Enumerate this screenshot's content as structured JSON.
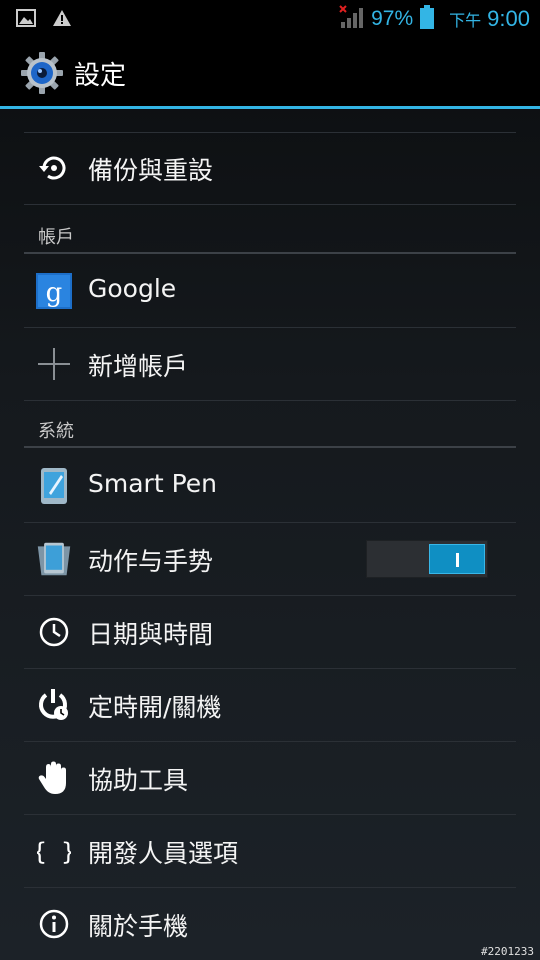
{
  "status_bar": {
    "battery_percent": "97%",
    "ampm": "下午",
    "time": "9:00",
    "icons": [
      "image-notification-icon",
      "warning-icon",
      "no-signal-icon",
      "battery-icon"
    ]
  },
  "action_bar": {
    "title": "設定",
    "icon": "settings-gear-icon"
  },
  "accent_color": "#33b5e5",
  "items": {
    "backup": {
      "label": "備份與重設",
      "icon": "backup-restore-icon"
    },
    "accounts_header": "帳戶",
    "google": {
      "label": "Google",
      "icon": "google-icon"
    },
    "add_account": {
      "label": "新增帳戶",
      "icon": "plus-icon"
    },
    "system_header": "系統",
    "smart_pen": {
      "label": "Smart Pen",
      "icon": "smart-pen-icon"
    },
    "motion": {
      "label": "动作与手势",
      "icon": "motion-phone-icon",
      "toggle_on": true
    },
    "date_time": {
      "label": "日期與時間",
      "icon": "clock-icon"
    },
    "schedule_power": {
      "label": "定時開/關機",
      "icon": "schedule-power-icon"
    },
    "accessibility": {
      "label": "協助工具",
      "icon": "hand-icon"
    },
    "developer": {
      "label": "開發人員選項",
      "icon": "braces-icon"
    },
    "about": {
      "label": "關於手機",
      "icon": "info-icon"
    }
  },
  "watermark": "#2201233"
}
